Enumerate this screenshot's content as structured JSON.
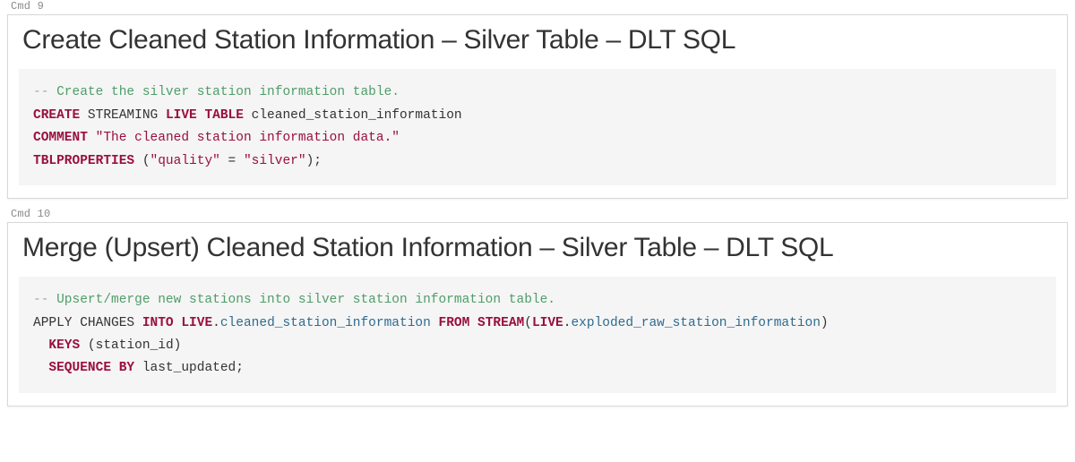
{
  "cells": [
    {
      "label": "Cmd 9",
      "heading": "Create Cleaned Station Information – Silver Table – DLT SQL",
      "code_tokens": [
        [
          {
            "t": "commentmarker",
            "v": "--"
          },
          {
            "t": "comment",
            "v": " Create the silver station information table."
          }
        ],
        [
          {
            "t": "kw",
            "v": "CREATE"
          },
          {
            "t": "id",
            "v": " STREAMING "
          },
          {
            "t": "kw",
            "v": "LIVE TABLE"
          },
          {
            "t": "id",
            "v": " cleaned_station_information"
          }
        ],
        [
          {
            "t": "kw",
            "v": "COMMENT"
          },
          {
            "t": "id",
            "v": " "
          },
          {
            "t": "str",
            "v": "\"The cleaned station information data.\""
          }
        ],
        [
          {
            "t": "kw",
            "v": "TBLPROPERTIES"
          },
          {
            "t": "id",
            "v": " "
          },
          {
            "t": "punct",
            "v": "("
          },
          {
            "t": "str",
            "v": "\"quality\""
          },
          {
            "t": "id",
            "v": " = "
          },
          {
            "t": "str",
            "v": "\"silver\""
          },
          {
            "t": "punct",
            "v": ");"
          }
        ]
      ]
    },
    {
      "label": "Cmd 10",
      "heading": "Merge (Upsert) Cleaned Station Information – Silver Table – DLT SQL",
      "code_tokens": [
        [
          {
            "t": "commentmarker",
            "v": "--"
          },
          {
            "t": "comment",
            "v": " Upsert/merge new stations into silver station information table."
          }
        ],
        [
          {
            "t": "id",
            "v": "APPLY CHANGES "
          },
          {
            "t": "kw",
            "v": "INTO"
          },
          {
            "t": "id",
            "v": " "
          },
          {
            "t": "kw",
            "v": "LIVE"
          },
          {
            "t": "punct",
            "v": "."
          },
          {
            "t": "obj",
            "v": "cleaned_station_information"
          },
          {
            "t": "id",
            "v": " "
          },
          {
            "t": "kw",
            "v": "FROM"
          },
          {
            "t": "id",
            "v": " "
          },
          {
            "t": "kw",
            "v": "STREAM"
          },
          {
            "t": "punct",
            "v": "("
          },
          {
            "t": "kw",
            "v": "LIVE"
          },
          {
            "t": "punct",
            "v": "."
          },
          {
            "t": "obj",
            "v": "exploded_raw_station_information"
          },
          {
            "t": "punct",
            "v": ")"
          }
        ],
        [
          {
            "t": "id",
            "v": "  "
          },
          {
            "t": "kw",
            "v": "KEYS"
          },
          {
            "t": "id",
            "v": " "
          },
          {
            "t": "punct",
            "v": "("
          },
          {
            "t": "id",
            "v": "station_id"
          },
          {
            "t": "punct",
            "v": ")"
          }
        ],
        [
          {
            "t": "id",
            "v": "  "
          },
          {
            "t": "kw",
            "v": "SEQUENCE BY"
          },
          {
            "t": "id",
            "v": " last_updated"
          },
          {
            "t": "punct",
            "v": ";"
          }
        ]
      ]
    }
  ]
}
